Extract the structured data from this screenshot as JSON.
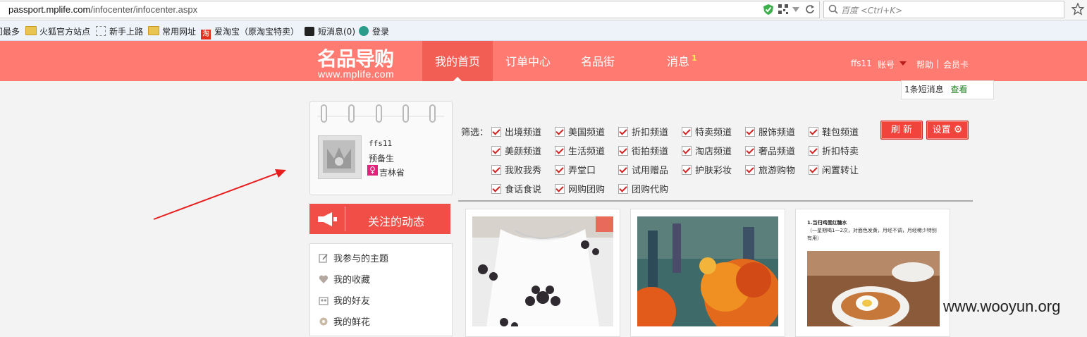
{
  "browser": {
    "url_host": "passport.mplife.com",
    "url_path": "/infocenter/infocenter.aspx",
    "search_placeholder": "百度 <Ctrl+K>"
  },
  "bookmarks": [
    "访问最多",
    "火狐官方站点",
    "新手上路",
    "常用网址",
    "爱淘宝（原淘宝特卖）",
    "短消息(0)",
    "登录"
  ],
  "logo": {
    "main": "名品导购",
    "sub": "www.mplife.com"
  },
  "nav": {
    "home": "我的首页",
    "orders": "订单中心",
    "street": "名品街",
    "messages": "消息",
    "messages_badge": "1"
  },
  "header_links": {
    "user": "ffs11",
    "account": "账号",
    "help": "帮助",
    "sep": "|",
    "vip": "会员卡"
  },
  "popup": {
    "text": "1条短消息",
    "link": "查看"
  },
  "profile": {
    "username": "ffs11",
    "level": "预备生",
    "gender_symbol": "♀",
    "region": "吉林省"
  },
  "follow_banner": "关注的动态",
  "menu": [
    "我参与的主题",
    "我的收藏",
    "我的好友",
    "我的鲜花"
  ],
  "filter": {
    "label": "筛选：",
    "rows": [
      [
        "出境频道",
        "美国频道",
        "折扣频道",
        "特卖频道",
        "服饰频道",
        "鞋包频道"
      ],
      [
        "美颜频道",
        "生活频道",
        "街拍频道",
        "淘店频道",
        "奢品频道",
        "折扣特卖"
      ],
      [
        "我败我秀",
        "弄堂口",
        "试用赠品",
        "护肤彩妆",
        "旅游购物",
        "闲置转让"
      ],
      [
        "食话食说",
        "网购团购",
        "团购代购"
      ]
    ]
  },
  "buttons": {
    "refresh": "刷 新",
    "settings": "设置"
  },
  "feed3": {
    "title": "1.当归鸡蛋红糖水",
    "desc": "（一星期喝1一2次，对面色发黄，月经不调，月经稀少特别有用）"
  },
  "watermark": "www.wooyun.org",
  "colors": {
    "brand": "#ff7b71",
    "nav_active": "#f25d54",
    "button": "#f0443c"
  }
}
